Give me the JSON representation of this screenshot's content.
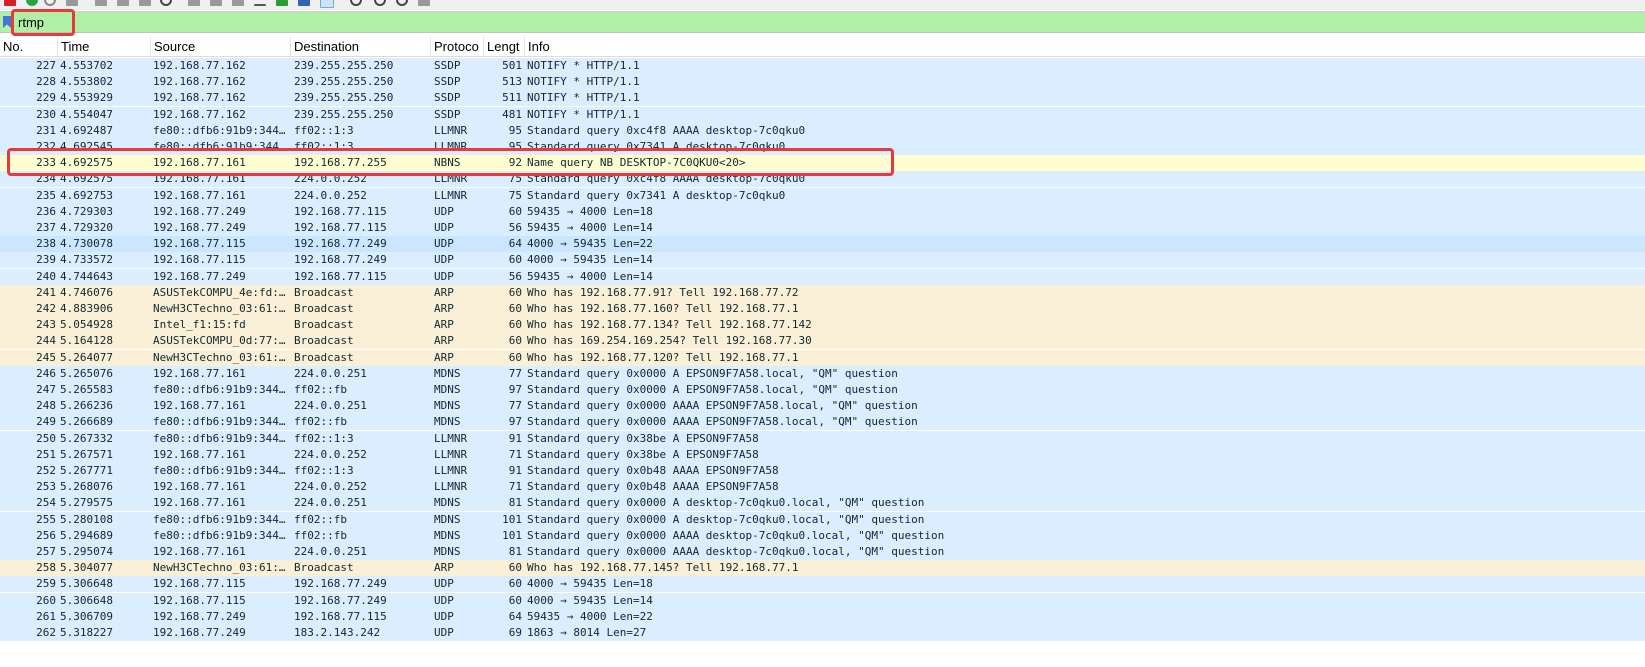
{
  "toolbar": {
    "icons": [
      "stop-capture-icon",
      "restart-capture-icon",
      "capture-options-icon",
      "open-file-icon",
      "save-file-icon",
      "close-file-icon",
      "reload-file-icon",
      "find-packet-icon",
      "go-back-icon",
      "go-forward-icon",
      "go-to-packet-icon",
      "go-first-icon",
      "go-last-icon",
      "auto-scroll-icon",
      "colorize-icon",
      "zoom-in-icon",
      "zoom-out-icon",
      "zoom-reset-icon",
      "resize-columns-icon"
    ]
  },
  "filter": {
    "value": "rtmp",
    "background": "#b0f0a6",
    "highlight_color": "#e83a3a"
  },
  "columns": [
    "No.",
    "Time",
    "Source",
    "Destination",
    "Protoco",
    "Lengt",
    "Info"
  ],
  "colors": {
    "udp_like": "#daeeff",
    "arp": "#faf0d7",
    "nbns": "#fefed0",
    "selected": "#cce6ff"
  },
  "packets": [
    {
      "no": "227",
      "time": "4.553702",
      "src": "192.168.77.162",
      "dst": "239.255.255.250",
      "proto": "SSDP",
      "len": "501",
      "info": "NOTIFY * HTTP/1.1",
      "cls": "p-ssdp"
    },
    {
      "no": "228",
      "time": "4.553802",
      "src": "192.168.77.162",
      "dst": "239.255.255.250",
      "proto": "SSDP",
      "len": "513",
      "info": "NOTIFY * HTTP/1.1",
      "cls": "p-ssdp"
    },
    {
      "no": "229",
      "time": "4.553929",
      "src": "192.168.77.162",
      "dst": "239.255.255.250",
      "proto": "SSDP",
      "len": "511",
      "info": "NOTIFY * HTTP/1.1",
      "cls": "p-ssdp"
    },
    {
      "no": "230",
      "time": "4.554047",
      "src": "192.168.77.162",
      "dst": "239.255.255.250",
      "proto": "SSDP",
      "len": "481",
      "info": "NOTIFY * HTTP/1.1",
      "cls": "p-ssdp"
    },
    {
      "no": "231",
      "time": "4.692487",
      "src": "fe80::dfb6:91b9:344…",
      "dst": "ff02::1:3",
      "proto": "LLMNR",
      "len": "95",
      "info": "Standard query 0xc4f8 AAAA desktop-7c0qku0",
      "cls": "p-llmnr"
    },
    {
      "no": "232",
      "time": "4.692545",
      "src": "fe80::dfb6:91b9:344…",
      "dst": "ff02::1:3",
      "proto": "LLMNR",
      "len": "95",
      "info": "Standard query 0x7341 A desktop-7c0qku0",
      "cls": "p-llmnr"
    },
    {
      "no": "233",
      "time": "4.692575",
      "src": "192.168.77.161",
      "dst": "192.168.77.255",
      "proto": "NBNS",
      "len": "92",
      "info": "Name query NB DESKTOP-7C0QKU0<20>",
      "cls": "p-nbns"
    },
    {
      "no": "234",
      "time": "4.692575",
      "src": "192.168.77.161",
      "dst": "224.0.0.252",
      "proto": "LLMNR",
      "len": "75",
      "info": "Standard query 0xc4f8 AAAA desktop-7c0qku0",
      "cls": "p-llmnr"
    },
    {
      "no": "235",
      "time": "4.692753",
      "src": "192.168.77.161",
      "dst": "224.0.0.252",
      "proto": "LLMNR",
      "len": "75",
      "info": "Standard query 0x7341 A desktop-7c0qku0",
      "cls": "p-llmnr"
    },
    {
      "no": "236",
      "time": "4.729303",
      "src": "192.168.77.249",
      "dst": "192.168.77.115",
      "proto": "UDP",
      "len": "60",
      "info": "59435 → 4000 Len=18",
      "cls": "p-udp"
    },
    {
      "no": "237",
      "time": "4.729320",
      "src": "192.168.77.249",
      "dst": "192.168.77.115",
      "proto": "UDP",
      "len": "56",
      "info": "59435 → 4000 Len=14",
      "cls": "p-udp"
    },
    {
      "no": "238",
      "time": "4.730078",
      "src": "192.168.77.115",
      "dst": "192.168.77.249",
      "proto": "UDP",
      "len": "64",
      "info": "4000 → 59435 Len=22",
      "cls": "p-udp selected"
    },
    {
      "no": "239",
      "time": "4.733572",
      "src": "192.168.77.115",
      "dst": "192.168.77.249",
      "proto": "UDP",
      "len": "60",
      "info": "4000 → 59435 Len=14",
      "cls": "p-udp"
    },
    {
      "no": "240",
      "time": "4.744643",
      "src": "192.168.77.249",
      "dst": "192.168.77.115",
      "proto": "UDP",
      "len": "56",
      "info": "59435 → 4000 Len=14",
      "cls": "p-udp"
    },
    {
      "no": "241",
      "time": "4.746076",
      "src": "ASUSTekCOMPU_4e:fd:…",
      "dst": "Broadcast",
      "proto": "ARP",
      "len": "60",
      "info": "Who has 192.168.77.91? Tell 192.168.77.72",
      "cls": "p-arp"
    },
    {
      "no": "242",
      "time": "4.883906",
      "src": "NewH3CTechno_03:61:…",
      "dst": "Broadcast",
      "proto": "ARP",
      "len": "60",
      "info": "Who has 192.168.77.160? Tell 192.168.77.1",
      "cls": "p-arp"
    },
    {
      "no": "243",
      "time": "5.054928",
      "src": "Intel_f1:15:fd",
      "dst": "Broadcast",
      "proto": "ARP",
      "len": "60",
      "info": "Who has 192.168.77.134? Tell 192.168.77.142",
      "cls": "p-arp"
    },
    {
      "no": "244",
      "time": "5.164128",
      "src": "ASUSTekCOMPU_0d:77:…",
      "dst": "Broadcast",
      "proto": "ARP",
      "len": "60",
      "info": "Who has 169.254.169.254? Tell 192.168.77.30",
      "cls": "p-arp"
    },
    {
      "no": "245",
      "time": "5.264077",
      "src": "NewH3CTechno_03:61:…",
      "dst": "Broadcast",
      "proto": "ARP",
      "len": "60",
      "info": "Who has 192.168.77.120? Tell 192.168.77.1",
      "cls": "p-arp"
    },
    {
      "no": "246",
      "time": "5.265076",
      "src": "192.168.77.161",
      "dst": "224.0.0.251",
      "proto": "MDNS",
      "len": "77",
      "info": "Standard query 0x0000 A EPSON9F7A58.local, \"QM\" question",
      "cls": "p-mdns"
    },
    {
      "no": "247",
      "time": "5.265583",
      "src": "fe80::dfb6:91b9:344…",
      "dst": "ff02::fb",
      "proto": "MDNS",
      "len": "97",
      "info": "Standard query 0x0000 A EPSON9F7A58.local, \"QM\" question",
      "cls": "p-mdns"
    },
    {
      "no": "248",
      "time": "5.266236",
      "src": "192.168.77.161",
      "dst": "224.0.0.251",
      "proto": "MDNS",
      "len": "77",
      "info": "Standard query 0x0000 AAAA EPSON9F7A58.local, \"QM\" question",
      "cls": "p-mdns"
    },
    {
      "no": "249",
      "time": "5.266689",
      "src": "fe80::dfb6:91b9:344…",
      "dst": "ff02::fb",
      "proto": "MDNS",
      "len": "97",
      "info": "Standard query 0x0000 AAAA EPSON9F7A58.local, \"QM\" question",
      "cls": "p-mdns"
    },
    {
      "no": "250",
      "time": "5.267332",
      "src": "fe80::dfb6:91b9:344…",
      "dst": "ff02::1:3",
      "proto": "LLMNR",
      "len": "91",
      "info": "Standard query 0x38be A EPSON9F7A58",
      "cls": "p-llmnr"
    },
    {
      "no": "251",
      "time": "5.267571",
      "src": "192.168.77.161",
      "dst": "224.0.0.252",
      "proto": "LLMNR",
      "len": "71",
      "info": "Standard query 0x38be A EPSON9F7A58",
      "cls": "p-llmnr"
    },
    {
      "no": "252",
      "time": "5.267771",
      "src": "fe80::dfb6:91b9:344…",
      "dst": "ff02::1:3",
      "proto": "LLMNR",
      "len": "91",
      "info": "Standard query 0x0b48 AAAA EPSON9F7A58",
      "cls": "p-llmnr"
    },
    {
      "no": "253",
      "time": "5.268076",
      "src": "192.168.77.161",
      "dst": "224.0.0.252",
      "proto": "LLMNR",
      "len": "71",
      "info": "Standard query 0x0b48 AAAA EPSON9F7A58",
      "cls": "p-llmnr"
    },
    {
      "no": "254",
      "time": "5.279575",
      "src": "192.168.77.161",
      "dst": "224.0.0.251",
      "proto": "MDNS",
      "len": "81",
      "info": "Standard query 0x0000 A desktop-7c0qku0.local, \"QM\" question",
      "cls": "p-mdns"
    },
    {
      "no": "255",
      "time": "5.280108",
      "src": "fe80::dfb6:91b9:344…",
      "dst": "ff02::fb",
      "proto": "MDNS",
      "len": "101",
      "info": "Standard query 0x0000 A desktop-7c0qku0.local, \"QM\" question",
      "cls": "p-mdns"
    },
    {
      "no": "256",
      "time": "5.294689",
      "src": "fe80::dfb6:91b9:344…",
      "dst": "ff02::fb",
      "proto": "MDNS",
      "len": "101",
      "info": "Standard query 0x0000 AAAA desktop-7c0qku0.local, \"QM\" question",
      "cls": "p-mdns"
    },
    {
      "no": "257",
      "time": "5.295074",
      "src": "192.168.77.161",
      "dst": "224.0.0.251",
      "proto": "MDNS",
      "len": "81",
      "info": "Standard query 0x0000 AAAA desktop-7c0qku0.local, \"QM\" question",
      "cls": "p-mdns"
    },
    {
      "no": "258",
      "time": "5.304077",
      "src": "NewH3CTechno_03:61:…",
      "dst": "Broadcast",
      "proto": "ARP",
      "len": "60",
      "info": "Who has 192.168.77.145? Tell 192.168.77.1",
      "cls": "p-arp"
    },
    {
      "no": "259",
      "time": "5.306648",
      "src": "192.168.77.115",
      "dst": "192.168.77.249",
      "proto": "UDP",
      "len": "60",
      "info": "4000 → 59435 Len=18",
      "cls": "p-udp"
    },
    {
      "no": "260",
      "time": "5.306648",
      "src": "192.168.77.115",
      "dst": "192.168.77.249",
      "proto": "UDP",
      "len": "60",
      "info": "4000 → 59435 Len=14",
      "cls": "p-udp"
    },
    {
      "no": "261",
      "time": "5.306709",
      "src": "192.168.77.249",
      "dst": "192.168.77.115",
      "proto": "UDP",
      "len": "64",
      "info": "59435 → 4000 Len=22",
      "cls": "p-udp"
    },
    {
      "no": "262",
      "time": "5.318227",
      "src": "192.168.77.249",
      "dst": "183.2.143.242",
      "proto": "UDP",
      "len": "69",
      "info": "1863 → 8014 Len=27",
      "cls": "p-udp"
    }
  ]
}
